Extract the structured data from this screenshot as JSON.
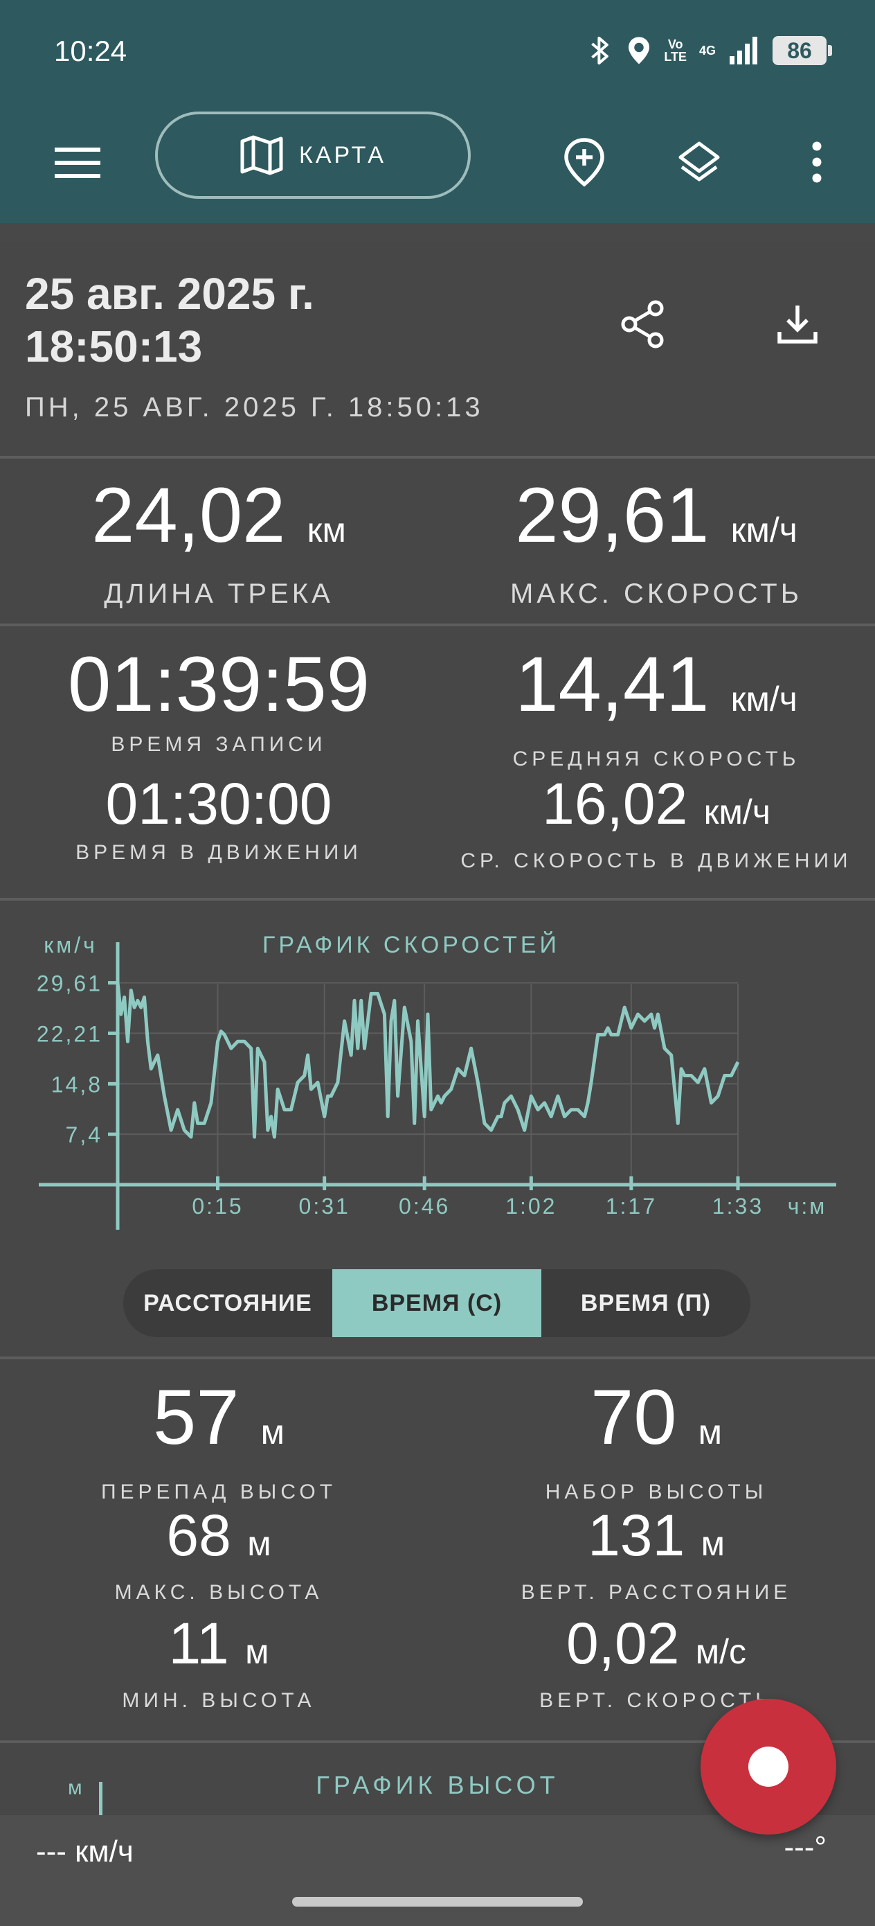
{
  "status": {
    "time": "10:24",
    "lte_top": "Vo",
    "lte_bottom": "LTE",
    "network": "4G",
    "battery": "86"
  },
  "appbar": {
    "map_label": "КАРТА"
  },
  "header": {
    "date_line1": "25 авг. 2025 г.",
    "date_line2": "18:50:13",
    "subtitle": "ПН, 25 АВГ. 2025 Г. 18:50:13"
  },
  "stats": {
    "track_length": {
      "value": "24,02",
      "unit": "км",
      "label": "ДЛИНА ТРЕКА"
    },
    "max_speed": {
      "value": "29,61",
      "unit": "км/ч",
      "label": "МАКС. СКОРОСТЬ"
    },
    "record_time": {
      "value": "01:39:59",
      "label": "ВРЕМЯ ЗАПИСИ"
    },
    "avg_speed": {
      "value": "14,41",
      "unit": "км/ч",
      "label": "СРЕДНЯЯ СКОРОСТЬ"
    },
    "moving_time": {
      "value": "01:30:00",
      "label": "ВРЕМЯ В ДВИЖЕНИИ"
    },
    "avg_moving_speed": {
      "value": "16,02",
      "unit": "км/ч",
      "label": "СР. СКОРОСТЬ В ДВИЖЕНИИ"
    },
    "elev_diff": {
      "value": "57",
      "unit": "м",
      "label": "ПЕРЕПАД ВЫСОТ"
    },
    "elev_gain": {
      "value": "70",
      "unit": "м",
      "label": "НАБОР ВЫСОТЫ"
    },
    "max_elev": {
      "value": "68",
      "unit": "м",
      "label": "МАКС. ВЫСОТА"
    },
    "vert_distance": {
      "value": "131",
      "unit": "м",
      "label": "ВЕРТ. РАССТОЯНИЕ"
    },
    "min_elev": {
      "value": "11",
      "unit": "м",
      "label": "МИН. ВЫСОТА"
    },
    "vert_speed": {
      "value": "0,02",
      "unit": "м/с",
      "label": "ВЕРТ. СКОРОСТЬ"
    }
  },
  "segmented": {
    "distance": "РАССТОЯНИЕ",
    "time_c": "ВРЕМЯ (С)",
    "time_p": "ВРЕМЯ (П)"
  },
  "elevation_chart": {
    "title": "ГРАФИК ВЫСОТ",
    "y_unit": "м"
  },
  "bottom": {
    "speed": "--- км/ч",
    "heading": "---°"
  },
  "colors": {
    "appbar": "#2e5a5f",
    "accent": "#8fcac2",
    "record": "#c8303e"
  },
  "chart_data": {
    "type": "line",
    "title": "ГРАФИК СКОРОСТЕЙ",
    "ylabel": "км/ч",
    "xlabel": "ч:м",
    "y_ticks": [
      "29,61",
      "22,21",
      "14,8",
      "7,4"
    ],
    "y_tick_values": [
      29.61,
      22.21,
      14.8,
      7.4
    ],
    "x_ticks": [
      "0:15",
      "0:31",
      "0:46",
      "1:02",
      "1:17",
      "1:33"
    ],
    "x_tick_values": [
      15,
      31,
      46,
      62,
      77,
      93
    ],
    "ylim": [
      0,
      31.5
    ],
    "xlim": [
      0,
      93
    ],
    "grid": true,
    "series": [
      {
        "x": [
          0,
          0.5,
          1,
          1.5,
          2,
          2.5,
          3,
          3.5,
          4,
          4.5,
          5,
          5.5,
          6,
          7,
          8,
          9,
          10,
          11,
          11.5,
          12,
          13,
          14,
          15,
          15.5,
          16,
          17,
          18,
          19,
          20,
          20.5,
          21,
          21.5,
          22,
          22.5,
          23,
          23.5,
          24,
          25,
          26,
          27,
          28,
          28.5,
          29,
          30,
          31,
          31.5,
          32,
          33,
          34,
          35,
          35.5,
          36,
          36.5,
          37,
          38,
          39,
          40,
          40.5,
          41,
          41.5,
          42,
          43,
          44,
          44.5,
          45,
          46,
          46.5,
          47,
          48,
          48.5,
          49,
          50,
          51,
          52,
          53,
          54,
          55,
          56,
          57,
          57.5,
          58,
          59,
          60,
          61,
          62,
          63,
          64,
          65,
          66,
          67,
          68,
          69,
          70,
          70.5,
          71,
          72,
          73,
          73.5,
          74,
          75,
          76,
          77,
          78,
          79,
          80,
          80.5,
          81,
          82,
          83,
          84,
          84.5,
          85,
          86,
          87,
          88,
          89,
          90,
          91,
          92,
          93
        ],
        "y": [
          29.61,
          25,
          27.5,
          21,
          28.5,
          26,
          27,
          26,
          27.5,
          21,
          17,
          18,
          19,
          13,
          8,
          11,
          8,
          7,
          12,
          9,
          9,
          12,
          21,
          22.5,
          22,
          20,
          21,
          21,
          20,
          7,
          20,
          19,
          18,
          8,
          10,
          7,
          14,
          11,
          11,
          15,
          16,
          19,
          14,
          15,
          10,
          13,
          13,
          15,
          24,
          19,
          27,
          20,
          27,
          20,
          28,
          28,
          25,
          10,
          24,
          27,
          13,
          26,
          21,
          9,
          24,
          10,
          25,
          11,
          13,
          12,
          13,
          14,
          17,
          16,
          20,
          15,
          9,
          8,
          10,
          10,
          12,
          13,
          11,
          8,
          13,
          11,
          12,
          10,
          13,
          10,
          11,
          11,
          10,
          12,
          15,
          22,
          22,
          23,
          22,
          22,
          26,
          23,
          25,
          24,
          25,
          23,
          25,
          20,
          19,
          9,
          17,
          16,
          16,
          15,
          17,
          12,
          13,
          16,
          16,
          18
        ]
      }
    ]
  }
}
